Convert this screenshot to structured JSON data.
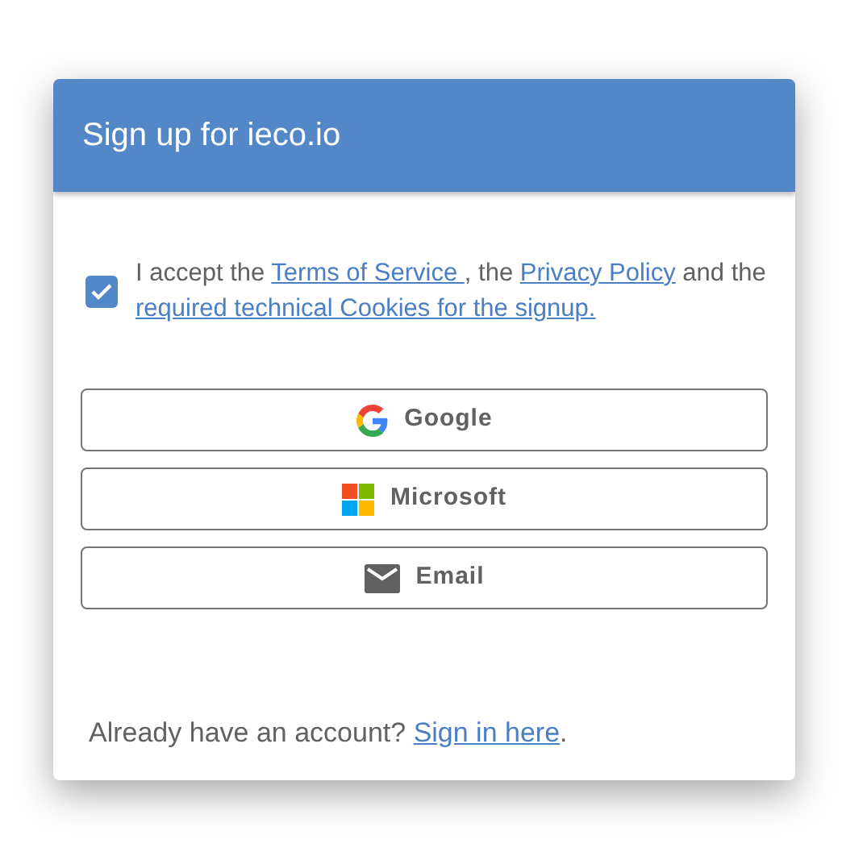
{
  "dialog": {
    "title": "Sign up for ieco.io"
  },
  "consent": {
    "checked": true,
    "parts": [
      {
        "kind": "text",
        "text": "I accept the "
      },
      {
        "kind": "link",
        "text": "Terms of Service "
      },
      {
        "kind": "text",
        "text": ", the "
      },
      {
        "kind": "link",
        "text": "Privacy Policy"
      },
      {
        "kind": "text",
        "text": " and the "
      },
      {
        "kind": "link",
        "text": "required technical Cookies for the signup."
      }
    ]
  },
  "buttons": [
    {
      "kind": "google",
      "label": "Google"
    },
    {
      "kind": "microsoft",
      "label": "Microsoft"
    },
    {
      "kind": "email",
      "label": "Email"
    }
  ],
  "footer": {
    "text": "Already have an account? ",
    "link": "Sign in here",
    "end": "."
  }
}
